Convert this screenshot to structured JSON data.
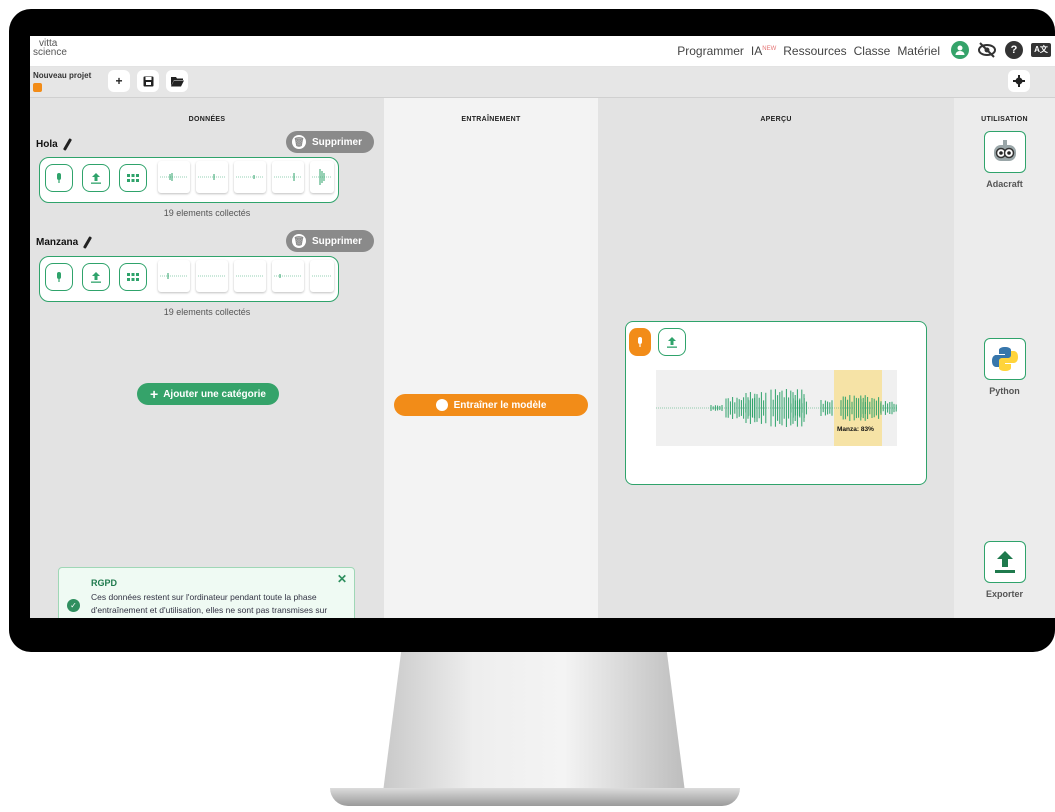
{
  "nav": {
    "logo_line1": "vitta",
    "logo_line2": "science",
    "links": [
      "Programmer",
      "IA",
      "Ressources",
      "Classe",
      "Matériel"
    ],
    "ia_badge": "NEW",
    "icons": [
      "user-icon",
      "eye-slash-icon",
      "help-icon",
      "language-icon"
    ]
  },
  "toolbar": {
    "project_name": "Nouveau projet",
    "new_icon": "plus-icon",
    "save_icon": "floppy-icon",
    "open_icon": "folder-open-icon",
    "settings_icon": "gear-icon"
  },
  "columns": {
    "data_title": "DONNÉES",
    "train_title": "ENTRAÎNEMENT",
    "preview_title": "APERÇU",
    "use_title": "UTILISATION"
  },
  "categories": [
    {
      "name": "Hola",
      "delete_label": "Supprimer",
      "collected": "19 elements collectés"
    },
    {
      "name": "Manzana",
      "delete_label": "Supprimer",
      "collected": "19 elements collectés"
    }
  ],
  "add_category_label": "Ajouter une catégorie",
  "rgpd": {
    "title": "RGPD",
    "text": "Ces données restent sur l'ordinateur pendant toute la phase d'entraînement et d'utilisation, elles ne sont pas transmises sur internet."
  },
  "train_button_label": "Entraîner le modèle",
  "preview": {
    "prediction_label": "Manza: 83%"
  },
  "usage": [
    {
      "label": "Adacraft",
      "icon": "robot-icon"
    },
    {
      "label": "Python",
      "icon": "python-icon"
    },
    {
      "label": "Exporter",
      "icon": "export-icon"
    }
  ],
  "colors": {
    "green": "#2fa36b",
    "orange": "#f28c18",
    "gray_button": "#8a8a8a"
  }
}
